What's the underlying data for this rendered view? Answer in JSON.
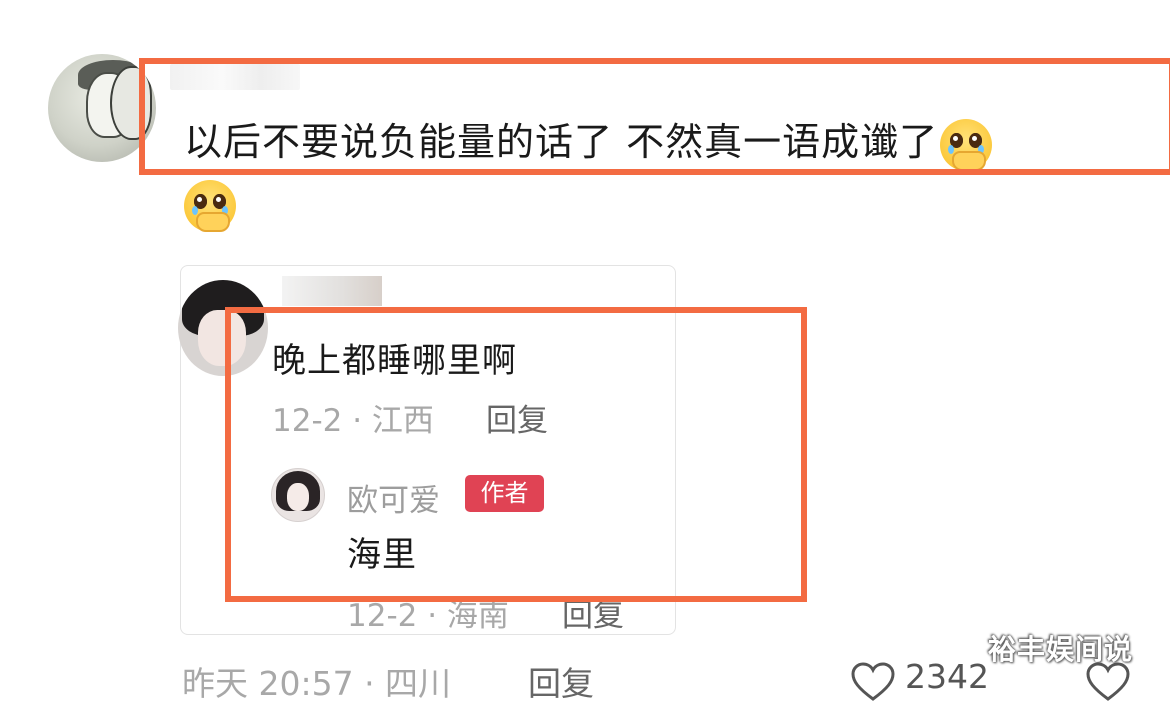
{
  "main_comment": {
    "text": "以后不要说负能量的话了 不然真一语成谶了",
    "emoji": "pleading-hand-over-mouth-emoji",
    "meta": "昨天 20:57 · 四川",
    "reply_label": "回复",
    "like_count": "2342"
  },
  "reply": {
    "text": "晚上都睡哪里啊",
    "meta": "12-2 · 江西",
    "reply_label": "回复"
  },
  "author_reply": {
    "username": "欧可爱",
    "badge": "作者",
    "text": "海里",
    "meta": "12-2 · 海南",
    "reply_label": "回复"
  },
  "watermark": "裕丰娱间说",
  "colors": {
    "highlight": "#f36b42",
    "author_badge": "#e04354"
  }
}
